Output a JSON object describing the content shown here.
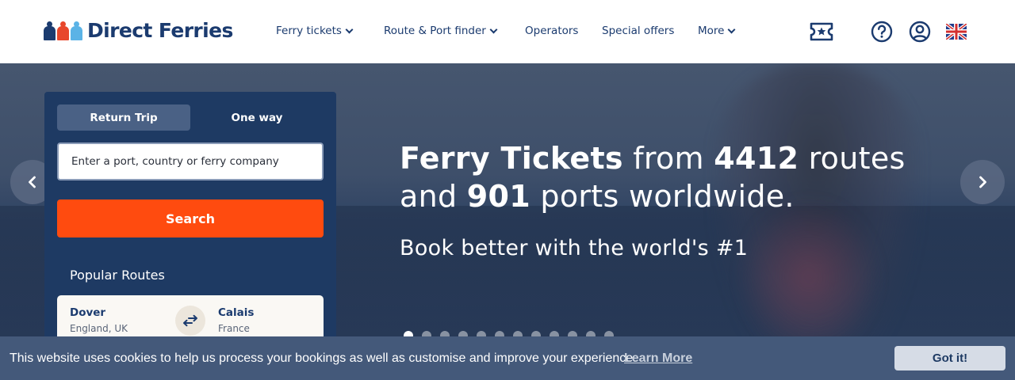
{
  "brand": {
    "name": "Direct Ferries",
    "colors": {
      "navy": "#1b3b6f",
      "orange": "#ff4b0f",
      "red": "#e8472b",
      "sky": "#5bb3e6"
    }
  },
  "nav": {
    "items": [
      {
        "label": "Ferry tickets",
        "has_dropdown": true
      },
      {
        "label": "Route & Port finder",
        "has_dropdown": true
      },
      {
        "label": "Operators",
        "has_dropdown": false
      },
      {
        "label": "Special offers",
        "has_dropdown": false
      },
      {
        "label": "More",
        "has_dropdown": true
      }
    ],
    "icons": [
      "ticket-icon",
      "help-icon",
      "account-icon",
      "uk-flag-icon"
    ]
  },
  "hero": {
    "headline": {
      "part1_bold": "Ferry Tickets",
      "part2": " from ",
      "routes_count": "4412",
      "part3": " routes and ",
      "ports_count": "901",
      "part4": " ports worldwide."
    },
    "subline": "Book better with the world's #1",
    "slide_count": 12,
    "active_slide": 1
  },
  "search": {
    "trip_types": [
      "Return Trip",
      "One way"
    ],
    "selected_trip": "Return Trip",
    "placeholder": "Enter a port, country or ferry company",
    "value": "",
    "button_label": "Search",
    "popular_title": "Popular Routes",
    "routes": [
      {
        "from": "Dover",
        "from_country": "England, UK",
        "to": "Calais",
        "to_country": "France"
      }
    ]
  },
  "cookie": {
    "text": "This website uses cookies to help us process your bookings as well as customise and improve your experience.",
    "link": "Learn More",
    "button": "Got it!"
  }
}
